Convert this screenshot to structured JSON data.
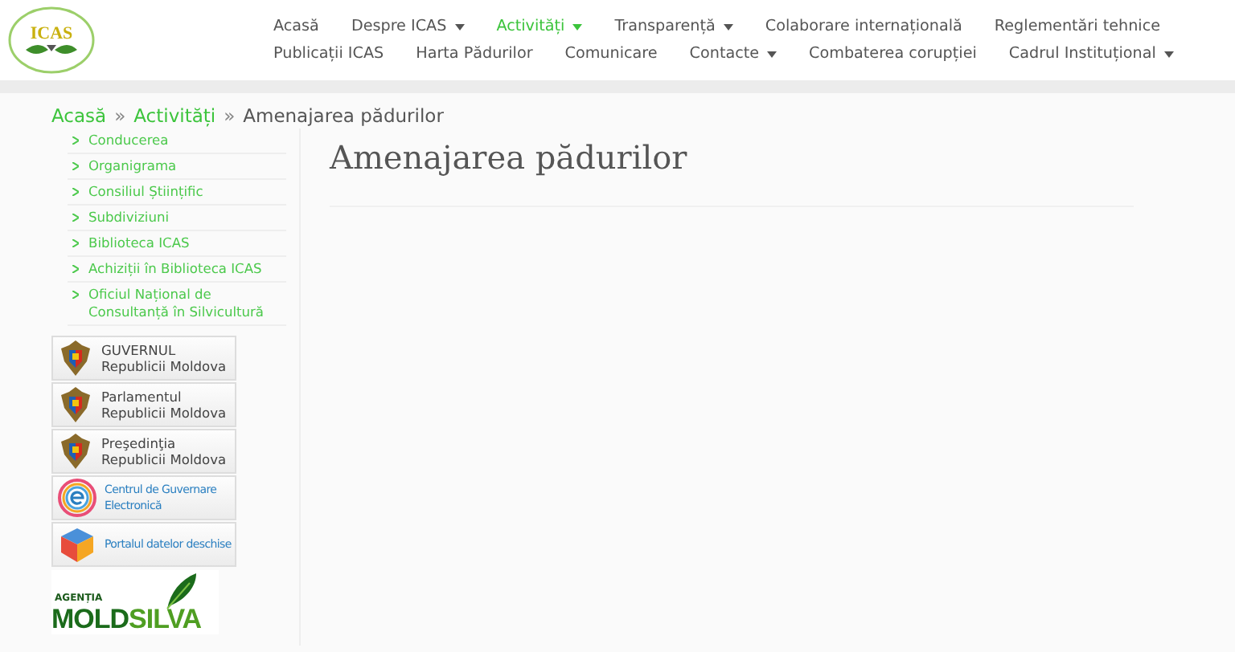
{
  "header": {
    "logo": {
      "text": "ICAS"
    },
    "nav_rows": [
      [
        {
          "label": "Acasă",
          "has_menu": false,
          "selected": false
        },
        {
          "label": "Despre ICAS",
          "has_menu": true,
          "selected": false
        },
        {
          "label": "Activități",
          "has_menu": true,
          "selected": true
        },
        {
          "label": "Transparență",
          "has_menu": true,
          "selected": false
        },
        {
          "label": "Colaborare internațională",
          "has_menu": false,
          "selected": false
        },
        {
          "label": "Reglementări tehnice",
          "has_menu": false,
          "selected": false
        }
      ],
      [
        {
          "label": "Publicații ICAS",
          "has_menu": false,
          "selected": false
        },
        {
          "label": "Harta Pădurilor",
          "has_menu": false,
          "selected": false
        },
        {
          "label": "Comunicare",
          "has_menu": false,
          "selected": false
        },
        {
          "label": "Contacte",
          "has_menu": true,
          "selected": false
        },
        {
          "label": "Combaterea corupției",
          "has_menu": false,
          "selected": false
        },
        {
          "label": "Cadrul Instituțional",
          "has_menu": true,
          "selected": false
        }
      ]
    ]
  },
  "breadcrumb": {
    "links": [
      "Acasă",
      "Activități"
    ],
    "separator": "»",
    "current": "Amenajarea pădurilor"
  },
  "sidebar": {
    "items": [
      "Conducerea",
      "Organigrama",
      "Consiliul Științific",
      "Subdiviziuni",
      "Biblioteca ICAS",
      "Achiziții în Biblioteca ICAS",
      "Oficiul Național de Consultanță în Silvicultură"
    ],
    "banners": [
      {
        "kind": "emblem",
        "lines": [
          "GUVERNUL",
          "Republicii Moldova"
        ]
      },
      {
        "kind": "emblem",
        "lines": [
          "Parlamentul",
          "Republicii Moldova"
        ]
      },
      {
        "kind": "emblem",
        "lines": [
          "Preşedinţia",
          "Republicii Moldova"
        ]
      },
      {
        "kind": "egov",
        "lines": [
          "Centrul de Guvernare",
          "Electronică"
        ]
      },
      {
        "kind": "cube",
        "lines": [
          "Portalul datelor deschise"
        ]
      }
    ],
    "agency_logo": {
      "caption": "AGENȚIA",
      "name_dark": "MOLD",
      "name_light": "SILVA"
    }
  },
  "content": {
    "title": "Amenajarea pădurilor"
  }
}
